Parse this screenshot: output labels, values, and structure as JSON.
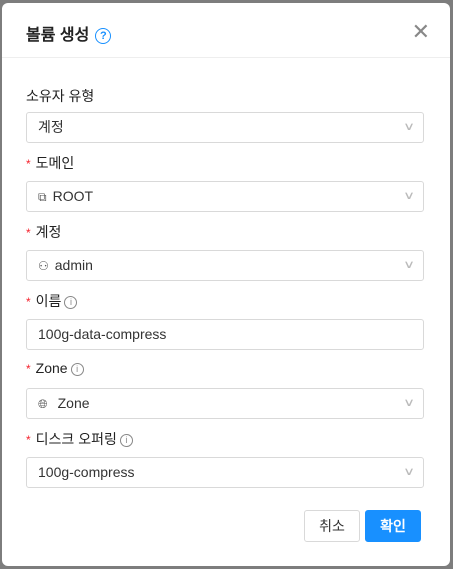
{
  "dialog": {
    "title": "볼륨 생성",
    "help_icon": "question-circle-icon",
    "close_icon": "close-icon"
  },
  "form": {
    "owner_type": {
      "label": "소유자 유형",
      "value": "계정"
    },
    "domain": {
      "label": "도메인",
      "value": "ROOT",
      "icon": "domain-icon"
    },
    "account": {
      "label": "계정",
      "value": "admin",
      "icon": "user-group-icon"
    },
    "name": {
      "label": "이름",
      "value": "100g-data-compress"
    },
    "zone": {
      "label": "Zone",
      "value": "Zone",
      "icon": "globe-icon"
    },
    "disk_offering": {
      "label": "디스크 오퍼링",
      "value": "100g-compress"
    }
  },
  "footer": {
    "cancel": "취소",
    "ok": "확인"
  },
  "colors": {
    "primary": "#1890ff",
    "required": "#f5222d"
  }
}
